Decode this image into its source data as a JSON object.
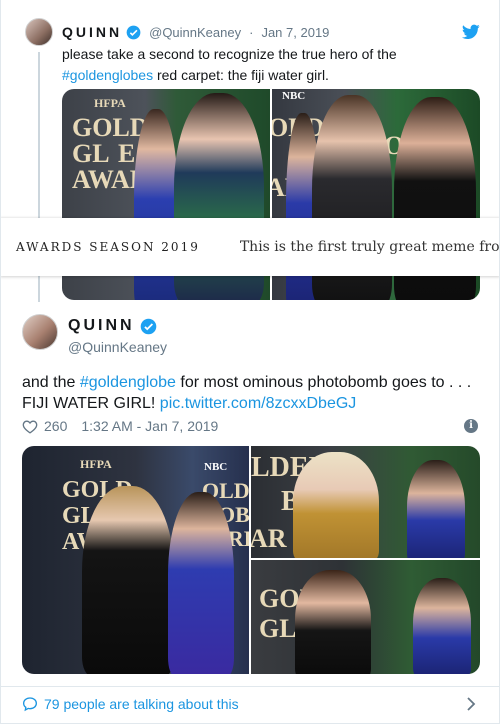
{
  "tweet1": {
    "name": "QUINN",
    "handle": "@QuinnKeaney",
    "date": "Jan 7, 2019",
    "separator": "·",
    "text_pre": "please take a second to recognize the true hero of the",
    "hashtag": "#goldenglobes",
    "text_post": "red carpet: the fiji water girl.",
    "board_a": [
      "HFPA",
      "GOLDE",
      "GL",
      "E",
      "AWAR"
    ],
    "board_b": [
      "NBC",
      "OLDE",
      "OBE",
      "AR"
    ]
  },
  "banner": {
    "section": "AWARDS SEASON 2019",
    "title": "This is the first truly great meme from the G"
  },
  "tweet2": {
    "name": "QUINN",
    "handle": "@QuinnKeaney",
    "text_pre": "and the",
    "hashtag": "#goldenglobe",
    "text_mid": "for most ominous photobomb goes to . . .",
    "text_line2": "FIJI WATER GIRL!",
    "link": "pic.twitter.com/8zcxxDbeGJ",
    "likes": "260",
    "timestamp": "1:32 AM - Jan 7, 2019",
    "board_left": [
      "HFPA",
      "GOLD",
      "GL",
      "AW"
    ],
    "board_left2": [
      "NBC",
      "OLDE",
      "OB",
      "ARDS"
    ],
    "board_tr": [
      "LDEN",
      "BE",
      "AR"
    ],
    "board_br": [
      "GOL",
      "GL"
    ]
  },
  "footer": {
    "talking": "79 people are talking about this"
  },
  "colors": {
    "link": "#1b95e0",
    "muted": "#657786",
    "verified": "#1da1f2"
  }
}
